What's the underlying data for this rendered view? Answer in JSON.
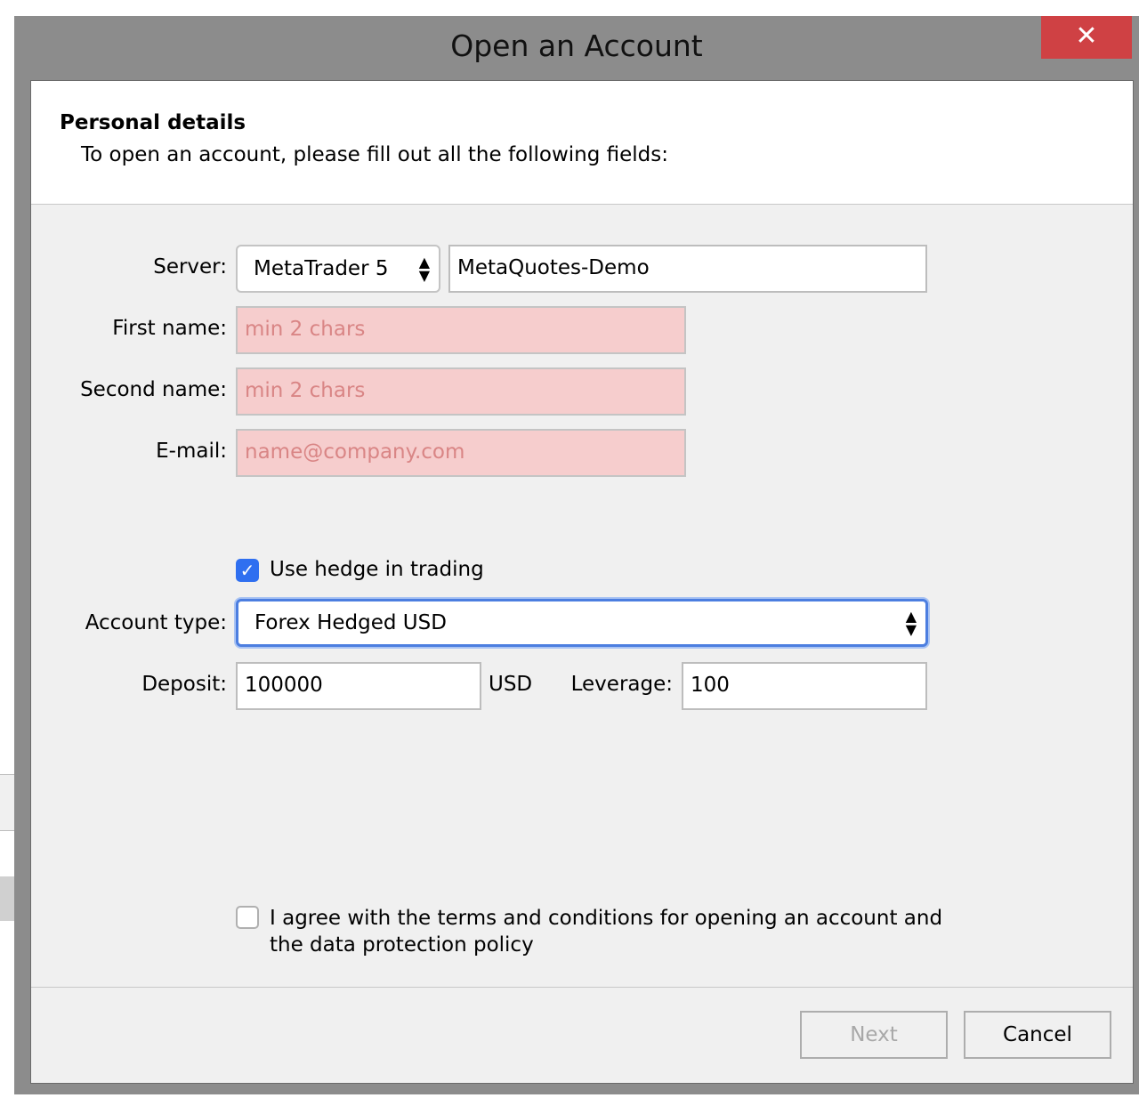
{
  "window": {
    "title": "Open an Account",
    "close_glyph": "✕"
  },
  "header": {
    "title": "Personal details",
    "subtitle": "To open an account, please fill out all the following fields:"
  },
  "form": {
    "server_label": "Server:",
    "server_platform": "MetaTrader 5",
    "server_name": "MetaQuotes-Demo",
    "first_name_label": "First name:",
    "first_name_placeholder": "min 2 chars",
    "second_name_label": "Second name:",
    "second_name_placeholder": "min 2 chars",
    "email_label": "E-mail:",
    "email_placeholder": "name@company.com",
    "hedge_label": "Use hedge in trading",
    "hedge_checked": true,
    "account_type_label": "Account type:",
    "account_type_value": "Forex Hedged USD",
    "deposit_label": "Deposit:",
    "deposit_value": "100000",
    "deposit_currency": "USD",
    "leverage_label": "Leverage:",
    "leverage_value": "100",
    "agree_label_line1": "I agree with the terms and conditions for opening an account and",
    "agree_label_line2": "the data protection policy",
    "agree_checked": false
  },
  "buttons": {
    "next": "Next",
    "cancel": "Cancel"
  },
  "colors": {
    "invalid_bg": "#f6cdcd",
    "focus_ring": "#4c7ee0",
    "close_red": "#cf4144",
    "checkbox_blue": "#2f6ff0"
  },
  "icons": {
    "close": "close-icon",
    "select_arrows": "updown-arrows-icon",
    "check": "checkmark-icon"
  }
}
